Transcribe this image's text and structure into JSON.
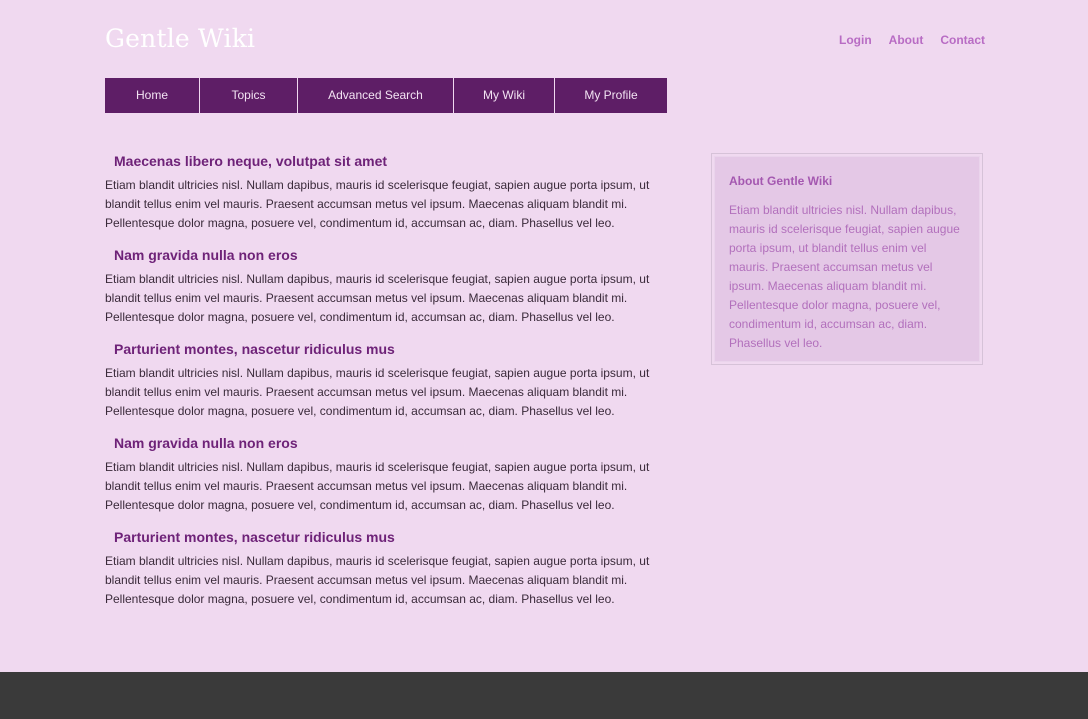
{
  "header": {
    "title": "Gentle Wiki",
    "links": [
      "Login",
      "About",
      "Contact"
    ]
  },
  "nav": {
    "items": [
      "Home",
      "Topics",
      "Advanced Search",
      "My Wiki",
      "My Profile"
    ]
  },
  "articles": [
    {
      "title": "Maecenas libero neque, volutpat sit amet",
      "body": "Etiam blandit ultricies nisl. Nullam dapibus, mauris id scelerisque feugiat, sapien augue porta ipsum, ut blandit tellus enim vel mauris. Praesent accumsan metus vel ipsum. Maecenas aliquam blandit mi. Pellentesque dolor magna, posuere vel, condimentum id, accumsan ac, diam. Phasellus vel leo."
    },
    {
      "title": "Nam gravida nulla non eros",
      "body": "Etiam blandit ultricies nisl. Nullam dapibus, mauris id scelerisque feugiat, sapien augue porta ipsum, ut blandit tellus enim vel mauris. Praesent accumsan metus vel ipsum. Maecenas aliquam blandit mi. Pellentesque dolor magna, posuere vel, condimentum id, accumsan ac, diam. Phasellus vel leo."
    },
    {
      "title": "Parturient montes, nascetur ridiculus mus",
      "body": "Etiam blandit ultricies nisl. Nullam dapibus, mauris id scelerisque feugiat, sapien augue porta ipsum, ut blandit tellus enim vel mauris. Praesent accumsan metus vel ipsum. Maecenas aliquam blandit mi. Pellentesque dolor magna, posuere vel, condimentum id, accumsan ac, diam. Phasellus vel leo."
    },
    {
      "title": "Nam gravida nulla non eros",
      "body": "Etiam blandit ultricies nisl. Nullam dapibus, mauris id scelerisque feugiat, sapien augue porta ipsum, ut blandit tellus enim vel mauris. Praesent accumsan metus vel ipsum. Maecenas aliquam blandit mi. Pellentesque dolor magna, posuere vel, condimentum id, accumsan ac, diam. Phasellus vel leo."
    },
    {
      "title": "Parturient montes, nascetur ridiculus mus",
      "body": "Etiam blandit ultricies nisl. Nullam dapibus, mauris id scelerisque feugiat, sapien augue porta ipsum, ut blandit tellus enim vel mauris. Praesent accumsan metus vel ipsum. Maecenas aliquam blandit mi. Pellentesque dolor magna, posuere vel, condimentum id, accumsan ac, diam. Phasellus vel leo."
    }
  ],
  "sidebar": {
    "title": "About Gentle Wiki",
    "body": "Etiam blandit ultricies nisl. Nullam dapibus, mauris id scelerisque feugiat, sapien augue porta ipsum, ut blandit tellus enim vel mauris. Praesent accumsan metus vel ipsum. Maecenas aliquam blandit mi. Pellentesque dolor magna, posuere vel, condimentum id, accumsan ac, diam. Phasellus vel leo."
  },
  "colors": {
    "background": "#f0d9f0",
    "nav_bg": "#5e1e66",
    "heading": "#6e2278",
    "link": "#b86cc4",
    "footer": "#3a3a3a"
  }
}
